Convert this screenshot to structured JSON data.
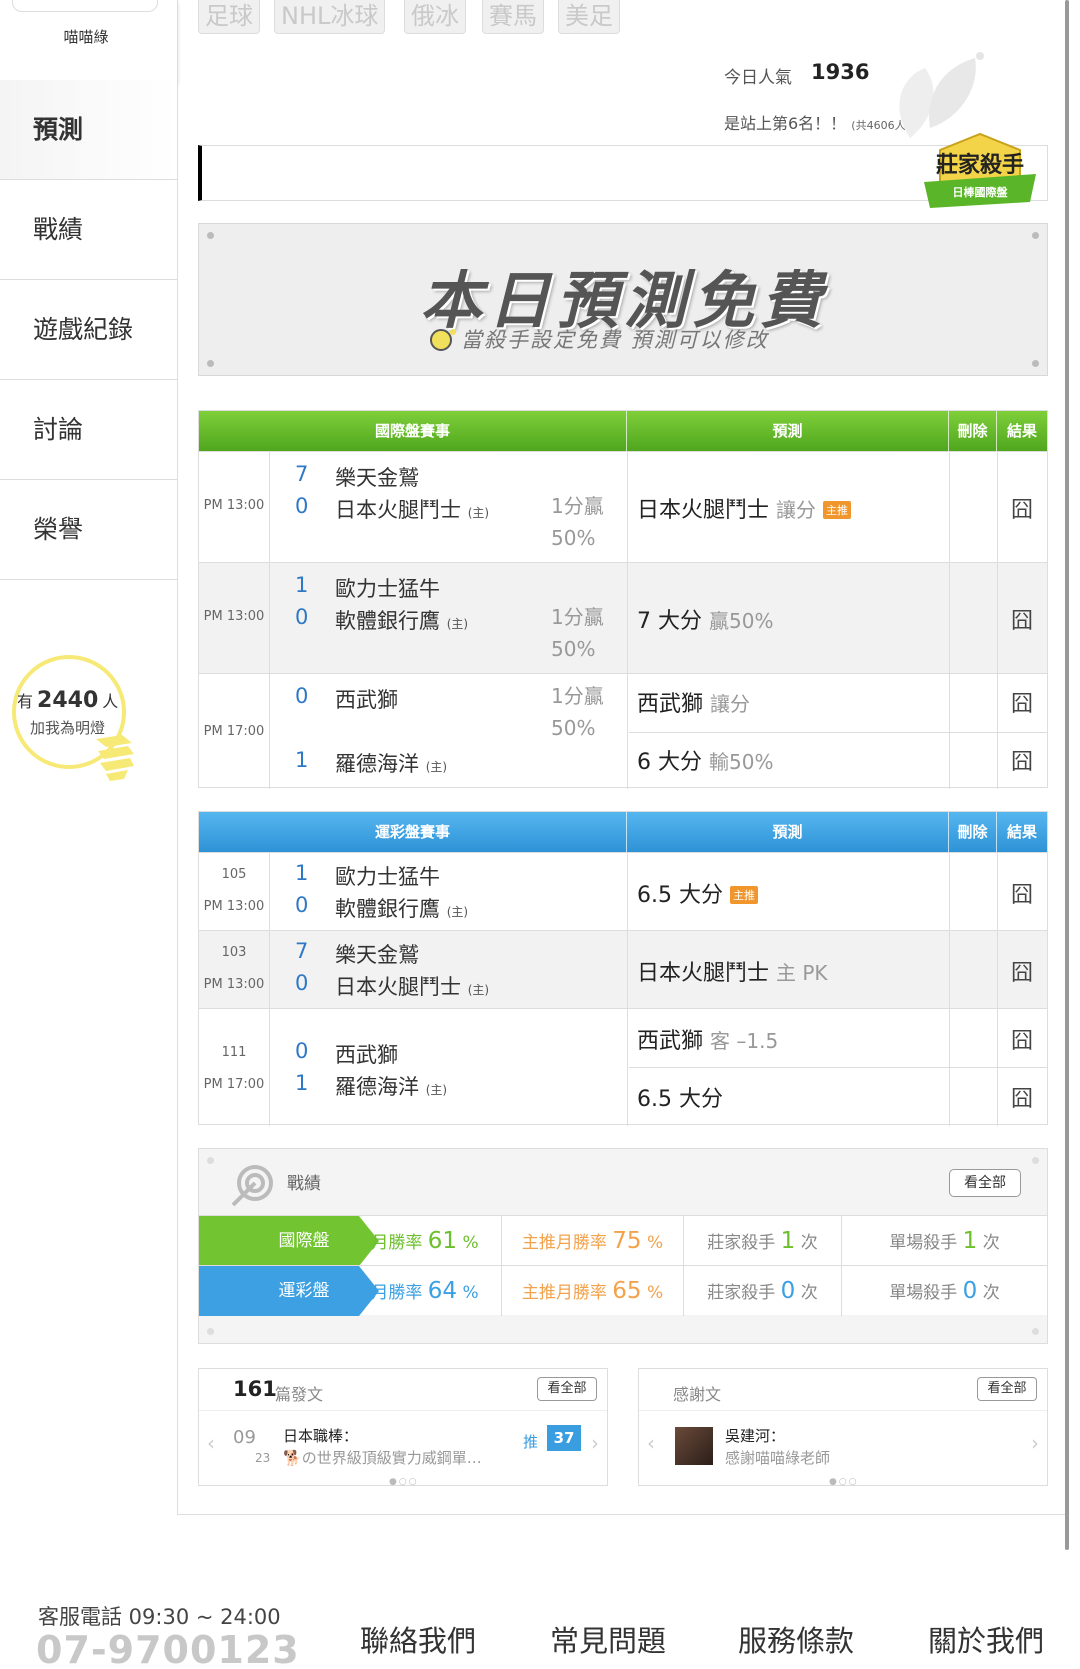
{
  "sidebar": {
    "username": "喵喵綠",
    "items": [
      {
        "label": "預測",
        "active": true
      },
      {
        "label": "戰績"
      },
      {
        "label": "遊戲紀錄"
      },
      {
        "label": "討論"
      },
      {
        "label": "榮譽"
      }
    ],
    "lamp": {
      "prefix": "有",
      "count": "2440",
      "suffix": "人",
      "caption": "加我為明燈"
    }
  },
  "sport_tabs": [
    "足球",
    "NHL冰球",
    "俄冰",
    "賽馬",
    "美足"
  ],
  "popularity": {
    "label": "今日人氣",
    "value": "1936",
    "rank_text": "是站上第6名！！",
    "total_text": "(共4606人)"
  },
  "badge": {
    "title": "莊家殺手",
    "subtitle": "日棒國際盤"
  },
  "banner": {
    "title": "本日預測免費",
    "subtitle": "當殺手設定免費  預測可以修改"
  },
  "intl_table": {
    "headers": {
      "event": "國際盤賽事",
      "prediction": "預測",
      "delete": "刪除",
      "result": "結果"
    },
    "rows": [
      {
        "time": "PM 13:00",
        "s1": "7",
        "t1": "樂天金鷲",
        "s2": "0",
        "t2": "日本火腿鬥士",
        "home": "(主)",
        "odds1": "1分贏",
        "odds2": "50%",
        "pred": "日本火腿鬥士",
        "pred_note": "讓分",
        "tag": "主推",
        "result": "囧"
      },
      {
        "time": "PM 13:00",
        "s1": "1",
        "t1": "歐力士猛牛",
        "s2": "0",
        "t2": "軟體銀行鷹",
        "home": "(主)",
        "odds1": "1分贏",
        "odds2": "50%",
        "pred": "7 大分",
        "pred_note": "贏50%",
        "result": "囧"
      },
      {
        "time": "PM 17:00",
        "s1": "0",
        "t1": "西武獅",
        "s2": "1",
        "t2": "羅德海洋",
        "home": "(主)",
        "odds1": "1分贏",
        "odds2": "50%",
        "pred": "西武獅",
        "pred_note": "讓分",
        "pred_b": "6 大分",
        "pred_b_note": "輸50%",
        "result": "囧",
        "result_b": "囧"
      }
    ]
  },
  "lottery_table": {
    "headers": {
      "event": "運彩盤賽事",
      "prediction": "預測",
      "delete": "刪除",
      "result": "結果"
    },
    "rows": [
      {
        "no": "105",
        "time": "PM 13:00",
        "s1": "1",
        "t1": "歐力士猛牛",
        "s2": "0",
        "t2": "軟體銀行鷹",
        "home": "(主)",
        "pred": "6.5 大分",
        "tag": "主推",
        "result": "囧"
      },
      {
        "no": "103",
        "time": "PM 13:00",
        "s1": "7",
        "t1": "樂天金鷲",
        "s2": "0",
        "t2": "日本火腿鬥士",
        "home": "(主)",
        "pred": "日本火腿鬥士",
        "pred_note": "主 PK",
        "result": "囧"
      },
      {
        "no": "111",
        "time": "PM 17:00",
        "s1": "0",
        "t1": "西武獅",
        "s2": "1",
        "t2": "羅德海洋",
        "home": "(主)",
        "pred": "西武獅",
        "pred_note": "客 –1.5",
        "pred_b": "6.5 大分",
        "result": "囧",
        "result_b": "囧"
      }
    ]
  },
  "record": {
    "title": "戰績",
    "see_all": "看全部",
    "rows": [
      {
        "label": "國際盤",
        "month_label": "月勝率",
        "month_val": "61",
        "pct": "%",
        "main_label": "主推月勝率",
        "main_val": "75",
        "killer_label": "莊家殺手",
        "killer_val": "1",
        "single_label": "單場殺手",
        "single_val": "1",
        "unit": "次"
      },
      {
        "label": "運彩盤",
        "month_label": "月勝率",
        "month_val": "64",
        "pct": "%",
        "main_label": "主推月勝率",
        "main_val": "65",
        "killer_label": "莊家殺手",
        "killer_val": "0",
        "single_label": "單場殺手",
        "single_val": "0",
        "unit": "次"
      }
    ]
  },
  "posts": {
    "count": "161",
    "label": "篇發文",
    "see_all": "看全部",
    "month": "09",
    "day": "23",
    "category": "日本職棒：",
    "snippet": "の世界級頂級實力威鋼單…",
    "push_label": "推",
    "push_count": "37"
  },
  "thanks": {
    "label": "感謝文",
    "see_all": "看全部",
    "author": "吳建河：",
    "snippet": "感謝喵喵綠老師"
  },
  "footer": {
    "hours": "客服電話 09:30 ~ 24:00",
    "phone": "07-9700123",
    "links": [
      "聯絡我們",
      "常見問題",
      "服務條款",
      "關於我們"
    ]
  },
  "colors": {
    "green": "#5cb825",
    "blue": "#3a9de0",
    "orange": "#f0962c",
    "score_blue": "#2f78c6"
  }
}
